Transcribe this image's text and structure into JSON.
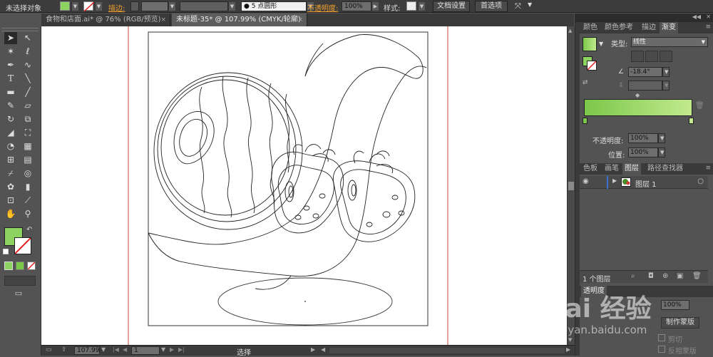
{
  "control_bar": {
    "selection_label": "未选择对象",
    "stroke_label": "描边:",
    "brush_label": "5 点圆形",
    "opacity_label": "不透明度:",
    "opacity_value": "100%",
    "style_label": "样式:",
    "doc_setup_button": "文档设置",
    "preferences_button": "首选项",
    "fill_color": "#8cd35f"
  },
  "tabs": [
    {
      "label": "食物和店面.ai* @ 76% (RGB/预览)",
      "close": "×"
    },
    {
      "label": "未标题-35* @ 107.99% (CMYK/轮廓)",
      "close": "×"
    }
  ],
  "status_bar": {
    "zoom": "107.99",
    "page": "1",
    "tool": "选择"
  },
  "color_panel_tabs": [
    "颜色",
    "颜色参考",
    "描边",
    "渐变"
  ],
  "gradient": {
    "type_label": "类型:",
    "type_value": "线性",
    "angle_value": "-18.4°",
    "opacity_label": "不透明度:",
    "opacity_value": "100%",
    "position_label": "位置:",
    "position_value": "100%",
    "start_color": "#7bc74a",
    "end_color": "#c2ea8e"
  },
  "layers_panel_tabs": [
    "色板",
    "画笔",
    "图层",
    "路径查找器"
  ],
  "layers": [
    {
      "name": "图层 1",
      "color": "#3b6fd4"
    }
  ],
  "layers_footer": "1 个图层",
  "transparency": {
    "tab_label": "透明度",
    "opacity_value": "100%",
    "make_mask_button": "制作蒙版",
    "clip_label": "剪切",
    "invert_label": "反相蒙版"
  },
  "watermark": {
    "brand": "Bai 经验",
    "url": "jingyan.baidu.com"
  },
  "toolbox": {
    "fill_color": "#8cd35f",
    "tools": [
      "selection-arrow",
      "direct-selection",
      "magic-wand",
      "lasso",
      "pen",
      "curvature",
      "type",
      "line-segment",
      "rectangle",
      "paintbrush",
      "pencil",
      "eraser",
      "rotate",
      "scale",
      "width",
      "free-transform",
      "shape-builder",
      "perspective",
      "mesh",
      "gradient",
      "eyedropper",
      "blend",
      "symbol-sprayer",
      "column-graph",
      "artboard",
      "slice",
      "hand",
      "zoom"
    ]
  }
}
